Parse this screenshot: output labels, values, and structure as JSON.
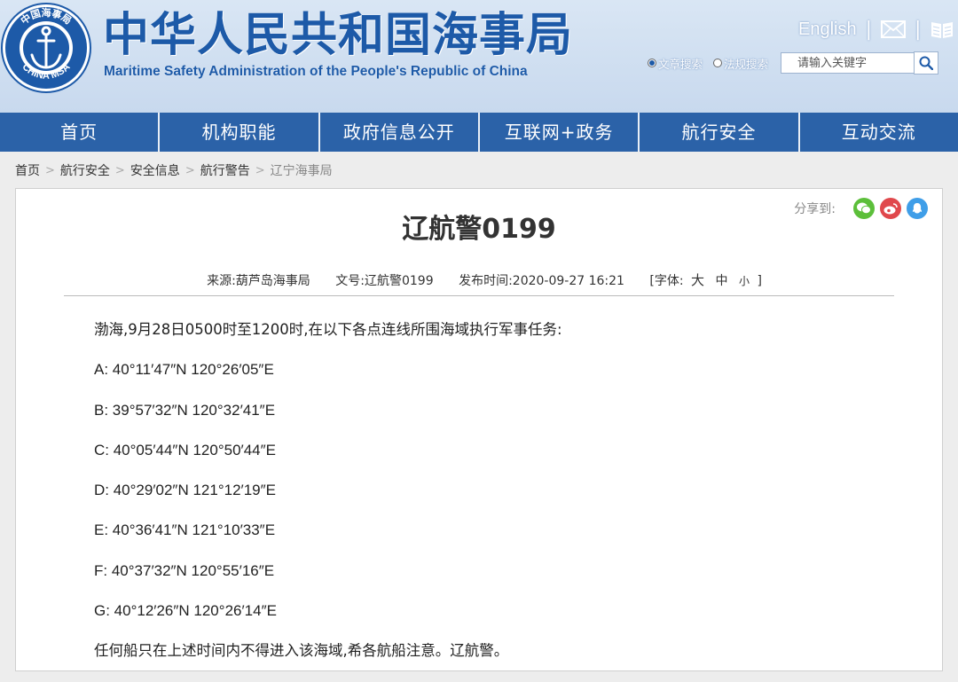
{
  "header": {
    "logo": {
      "top_text": "中国海事局",
      "bottom_text": "CHINA MSA"
    },
    "title": "中华人民共和国海事局",
    "subtitle": "Maritime Safety Administration of the People's Republic of China",
    "english_link": "English",
    "separator": "|",
    "icons": [
      "mail-icon",
      "book-icon"
    ],
    "search": {
      "options": [
        {
          "label": "文章搜索",
          "checked": true
        },
        {
          "label": "法规搜索",
          "checked": false
        }
      ],
      "placeholder": "请输入关键字"
    }
  },
  "nav": {
    "items": [
      {
        "label": "首页"
      },
      {
        "label": "机构职能"
      },
      {
        "label": "政府信息公开"
      },
      {
        "label": "互联网+政务"
      },
      {
        "label": "航行安全"
      },
      {
        "label": "互动交流"
      }
    ]
  },
  "breadcrumb": {
    "separator": ">",
    "items": [
      "首页",
      "航行安全",
      "安全信息",
      "航行警告",
      "辽宁海事局"
    ]
  },
  "article": {
    "share_label": "分享到:",
    "share_icons": [
      "wechat-icon",
      "weibo-icon",
      "qzone-icon"
    ],
    "title": "辽航警0199",
    "meta": {
      "source": "来源:葫芦岛海事局",
      "doc_no": "文号:辽航警0199",
      "published": "发布时间:2020-09-27 16:21",
      "font_label": "[字体:",
      "font_large": "大",
      "font_medium": "中",
      "font_small": "小",
      "font_close": "]"
    },
    "intro": "渤海,9月28日0500时至1200时,在以下各点连线所围海域执行军事任务:",
    "points": [
      "A: 40°11′47″N 120°26′05″E",
      "B: 39°57′32″N 120°32′41″E",
      "C: 40°05′44″N 120°50′44″E",
      "D: 40°29′02″N 121°12′19″E",
      "E: 40°36′41″N 121°10′33″E",
      "F: 40°37′32″N 120°55′16″E",
      "G: 40°12′26″N 120°26′14″E"
    ],
    "closing": "任何船只在上述时间内不得进入该海域,希各航船注意。辽航警。"
  }
}
